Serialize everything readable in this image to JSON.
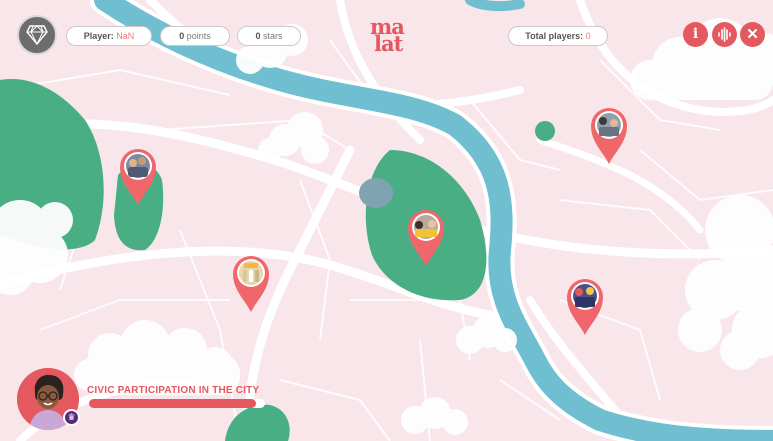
{
  "header": {
    "player_label": "Player:",
    "player_value": "NaN",
    "points_value": "0",
    "points_label": "points",
    "stars_value": "0",
    "stars_label": "stars",
    "total_players_label": "Total players:",
    "total_players_value": "0",
    "logo_line1": "ma",
    "logo_line2": "lat",
    "info_label": "i",
    "close_label": "✕"
  },
  "icons": {
    "menu": "diamond-icon",
    "info": "info-icon",
    "sound": "sound-wave-icon",
    "close": "close-icon",
    "badge": "trophy-icon"
  },
  "mission": {
    "title": "CIVIC PARTICIPATION IN THE CITY",
    "progress": 0.95
  },
  "map": {
    "pins": [
      {
        "name": "location-pin-park-west"
      },
      {
        "name": "location-pin-market"
      },
      {
        "name": "location-pin-central-park"
      },
      {
        "name": "location-pin-northeast"
      },
      {
        "name": "location-pin-riverside-east"
      }
    ]
  },
  "colors": {
    "accent": "#e4595f",
    "river": "#6fbfd1",
    "park": "#4aae85",
    "ground": "#f8e6ea",
    "road": "#ffffff",
    "cloud": "#ffffff",
    "pin": "#f0676b",
    "badge": "#5a2a7a"
  }
}
